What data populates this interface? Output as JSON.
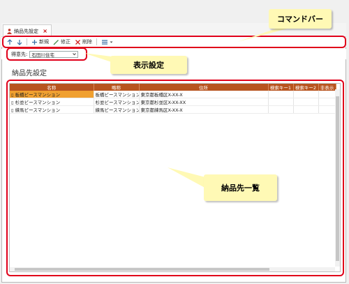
{
  "tab": {
    "title": "納品先設定",
    "close": "×"
  },
  "toolbar": {
    "new_label": "新規",
    "edit_label": "修正",
    "delete_label": "削除"
  },
  "filter": {
    "label": "得意先:",
    "value": "石田川住宅"
  },
  "page_title": "納品先設定",
  "table": {
    "columns": [
      "名称",
      "略称",
      "住所",
      "検索キー1",
      "検索キー2",
      "非表示"
    ],
    "rows": [
      {
        "name": "板橋ビースマンション",
        "abbr": "板橋ビースマンション",
        "address": "東京都板橋区X-XX-X",
        "key1": "",
        "key2": "",
        "hidden": ""
      },
      {
        "name": "杉並ビースマンション",
        "abbr": "杉並ビースマンション",
        "address": "東京都杉並区X-XX-XX",
        "key1": "",
        "key2": "",
        "hidden": ""
      },
      {
        "name": "練馬ビースマンション",
        "abbr": "練馬ビースマンション",
        "address": "東京都練馬区X-XX-X",
        "key1": "",
        "key2": "",
        "hidden": ""
      }
    ]
  },
  "callouts": {
    "command_bar": "コマンドバー",
    "display_settings": "表示設定",
    "delivery_list": "納品先一覧"
  },
  "colors": {
    "header": "#b8541f",
    "selected_cell": "#f0a030",
    "highlight": "#e0001a",
    "callout_bg": "#fff9b5"
  }
}
